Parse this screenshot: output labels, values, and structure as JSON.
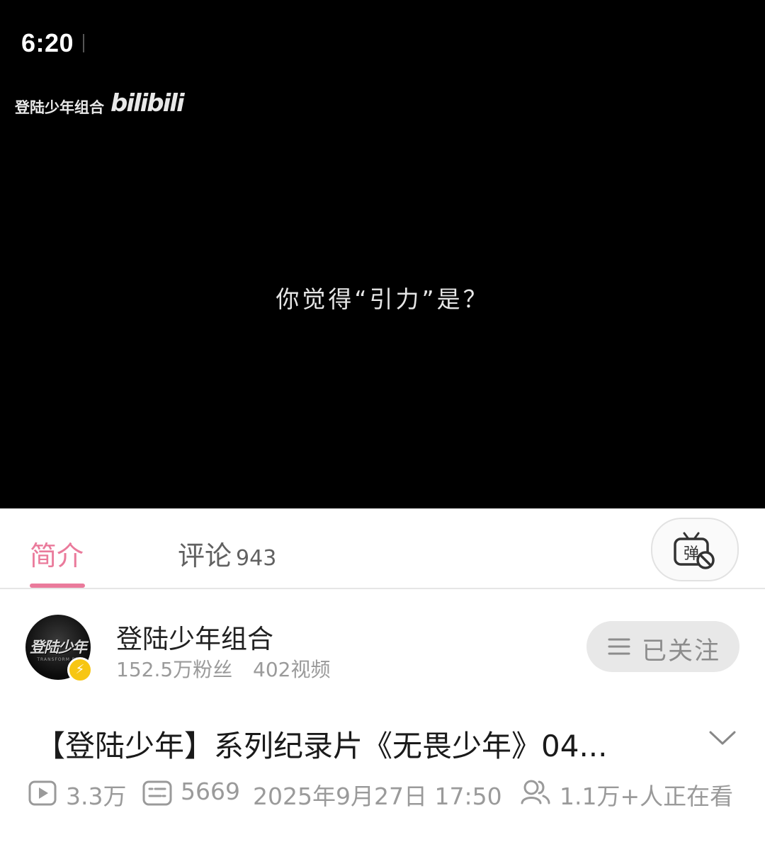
{
  "status_bar": {
    "time": "6:20"
  },
  "player": {
    "watermark_channel": "登陆少年组合",
    "watermark_logo": "bilibili",
    "subtitle": "你觉得“引力”是？"
  },
  "tabs": {
    "intro_label": "简介",
    "comments_label": "评论",
    "comments_count": "943",
    "danmaku_icon_char": "弹"
  },
  "author": {
    "avatar_text": "登陆少年",
    "avatar_subtext": "TRANSFORM PR",
    "name": "登陆少年组合",
    "fans": "152.5万粉丝",
    "videos": "402视频",
    "follow_label": "已关注"
  },
  "video": {
    "title": "【登陆少年】系列纪录片《无畏少年》04...",
    "views": "3.3万",
    "danmaku_count": "5669",
    "publish_time": "2025年9月27日 17:50",
    "watching_now": "1.1万+人正在看"
  },
  "colors": {
    "accent": "#ea7a9b",
    "badge": "#f7c613",
    "muted": "#9a9a9a"
  },
  "icons": {
    "danmaku": "danmaku-off-icon",
    "follow": "menu-icon",
    "expand": "chevron-down-icon",
    "views": "play-icon",
    "danmaku_count": "danmaku-icon",
    "watching": "people-icon",
    "verified": "lightning-icon"
  }
}
